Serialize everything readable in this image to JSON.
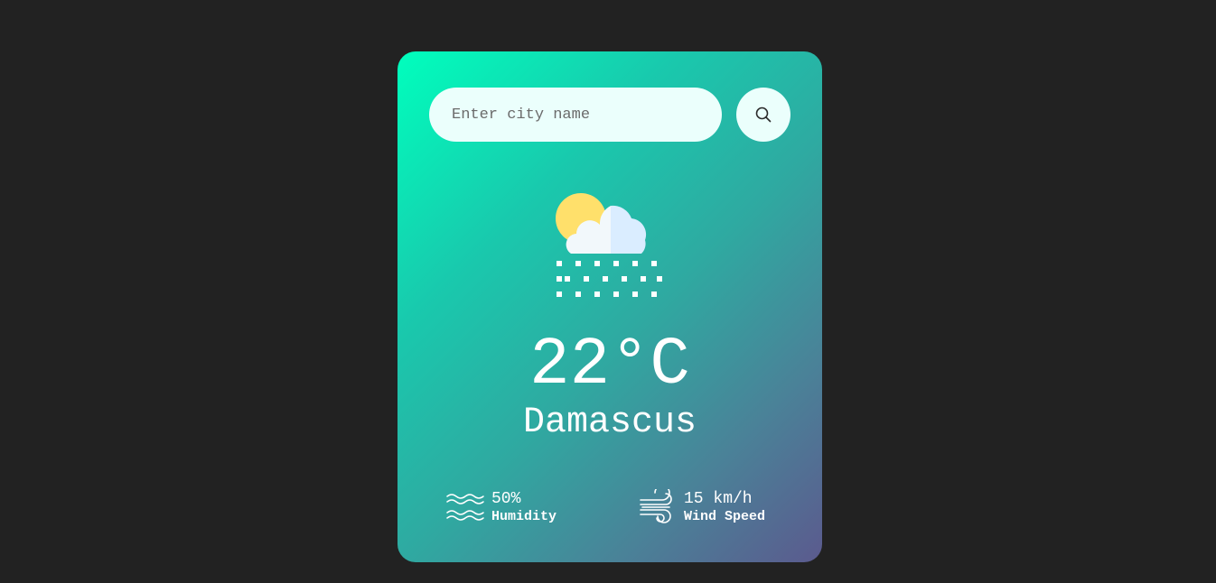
{
  "search": {
    "placeholder": "Enter city name",
    "value": "",
    "button_icon": "search-icon"
  },
  "weather": {
    "icon": "sun-cloud-snow-icon",
    "temperature": "22°C",
    "city": "Damascus"
  },
  "details": {
    "humidity": {
      "icon": "humidity-waves-icon",
      "value": "50%",
      "label": "Humidity"
    },
    "wind": {
      "icon": "wind-icon",
      "value": "15 km/h",
      "label": "Wind Speed"
    }
  },
  "colors": {
    "background": "#222222",
    "card_gradient_start": "#00ffbd",
    "card_gradient_end": "#5b5a8e",
    "input_background": "#ebfffc",
    "text": "#ffffff"
  }
}
